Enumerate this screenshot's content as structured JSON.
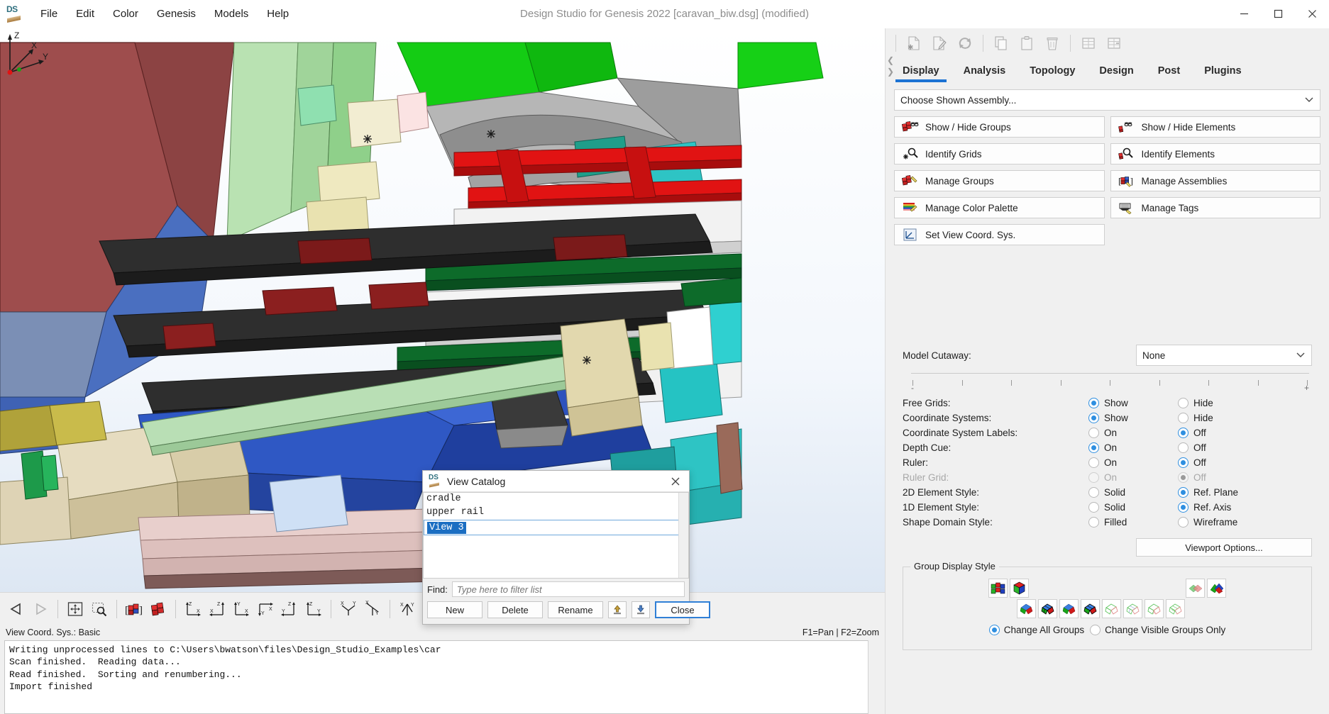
{
  "titlebar": {
    "logo": "ds-logo",
    "title": "Design Studio for Genesis 2022 [caravan_biw.dsg] (modified)",
    "menus": [
      "File",
      "Edit",
      "Color",
      "Genesis",
      "Models",
      "Help"
    ],
    "minimize": "—",
    "maximize": "☐",
    "close": "✕"
  },
  "right_panel": {
    "tabs": [
      "Display",
      "Analysis",
      "Topology",
      "Design",
      "Post",
      "Plugins"
    ],
    "active_tab": "Display",
    "assembly_combo": {
      "value": "Choose Shown Assembly...",
      "chevron": "⌄"
    },
    "buttons_left": [
      {
        "label": "Show / Hide Groups",
        "icon": "groups-glasses-icon"
      },
      {
        "label": "Identify Grids",
        "icon": "grid-magnifier-icon"
      },
      {
        "label": "Manage Groups",
        "icon": "groups-pencil-icon"
      },
      {
        "label": "Manage Color Palette",
        "icon": "color-palette-icon"
      },
      {
        "label": "Set View Coord. Sys.",
        "icon": "coord-sys-icon"
      }
    ],
    "buttons_right": [
      {
        "label": "Show / Hide Elements",
        "icon": "element-glasses-icon"
      },
      {
        "label": "Identify Elements",
        "icon": "element-magnifier-icon"
      },
      {
        "label": "Manage Assemblies",
        "icon": "assemblies-icon"
      },
      {
        "label": "Manage Tags",
        "icon": "tags-icon"
      }
    ],
    "cutaway": {
      "label": "Model Cutaway:",
      "value": "None",
      "chevron": "⌄",
      "slider_left": "-",
      "slider_right": "+"
    },
    "options": [
      {
        "label": "Free Grids:",
        "opt1": "Show",
        "opt2": "Hide",
        "selected": 1,
        "disabled": false
      },
      {
        "label": "Coordinate Systems:",
        "opt1": "Show",
        "opt2": "Hide",
        "selected": 1,
        "disabled": false
      },
      {
        "label": "Coordinate System Labels:",
        "opt1": "On",
        "opt2": "Off",
        "selected": 2,
        "disabled": false
      },
      {
        "label": "Depth Cue:",
        "opt1": "On",
        "opt2": "Off",
        "selected": 1,
        "disabled": false
      },
      {
        "label": "Ruler:",
        "opt1": "On",
        "opt2": "Off",
        "selected": 2,
        "disabled": false
      },
      {
        "label": "Ruler Grid:",
        "opt1": "On",
        "opt2": "Off",
        "selected": 2,
        "disabled": true
      },
      {
        "label": "2D Element Style:",
        "opt1": "Solid",
        "opt2": "Ref. Plane",
        "selected": 2,
        "disabled": false
      },
      {
        "label": "1D Element Style:",
        "opt1": "Solid",
        "opt2": "Ref. Axis",
        "selected": 2,
        "disabled": false
      },
      {
        "label": "Shape Domain Style:",
        "opt1": "Filled",
        "opt2": "Wireframe",
        "selected": 0,
        "disabled": false
      }
    ],
    "viewport_options_label": "Viewport Options...",
    "group_display_style": {
      "legend": "Group Display Style",
      "radio_all": "Change All Groups",
      "radio_visible": "Change Visible Groups Only",
      "selected": "all"
    },
    "toolbar_icons": [
      "new-file-icon",
      "edit-file-icon",
      "refresh-icon",
      "copy-icon",
      "paste-icon",
      "delete-icon",
      "table-icon",
      "table-plus-icon"
    ]
  },
  "viewport": {
    "axis_labels": {
      "x": "X",
      "y": "Y",
      "z": "Z"
    }
  },
  "view_toolbar": {
    "icons": [
      "prev-view-icon",
      "next-view-icon",
      "fit-view-icon",
      "zoom-box-icon",
      "show-assembly-icon",
      "show-group-icon",
      "view-xz-icon",
      "view-zx-icon",
      "view-yx-icon",
      "view-xy-icon",
      "view-zy-icon",
      "view-zy2-icon",
      "iso-view-1-icon",
      "iso-view-2-icon",
      "iso-view-3-icon",
      "iso-view-4-icon",
      "mirror-x-icon",
      "mirror-y-icon",
      "mirror-z-icon"
    ],
    "overflow": "..."
  },
  "statusbar": {
    "coord_sys": "View Coord. Sys.: Basic",
    "hint": "F1=Pan | F2=Zoom"
  },
  "console": {
    "lines": [
      "Writing unprocessed lines to C:\\Users\\bwatson\\files\\Design_Studio_Examples\\car",
      "Scan finished.  Reading data...",
      "Read finished.  Sorting and renumbering...",
      "Import finished"
    ]
  },
  "dialog": {
    "title": "View Catalog",
    "logo": "ds-logo",
    "close": "✕",
    "list_items": [
      "cradle",
      "upper rail",
      "View 3"
    ],
    "selected_index": 2,
    "find": {
      "label": "Find:",
      "value": "",
      "placeholder": "Type here to filter list"
    },
    "buttons": {
      "new": "New",
      "delete": "Delete",
      "rename": "Rename",
      "import_icon": "import-arrow-icon",
      "export_icon": "export-arrow-icon",
      "close": "Close"
    }
  }
}
